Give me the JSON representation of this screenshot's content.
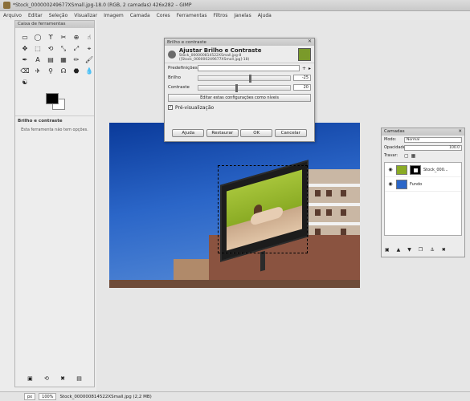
{
  "window": {
    "title": "*Stock_000000249677XSmall.jpg-18.0 (RGB, 2 camadas) 426x282 – GIMP"
  },
  "menu": [
    "Arquivo",
    "Editar",
    "Seleção",
    "Visualizar",
    "Imagem",
    "Camada",
    "Cores",
    "Ferramentas",
    "Filtros",
    "Janelas",
    "Ajuda"
  ],
  "toolbox": {
    "title": "Caixa de ferramentas",
    "tools": [
      "▭",
      "◯",
      "ϒ",
      "✂",
      "⊕",
      "☝",
      "✥",
      "⬚",
      "⟲",
      "⤡",
      "⤢",
      "⌖",
      "✒",
      "A",
      "▤",
      "▦",
      "✏",
      "🖌",
      "⌫",
      "✈",
      "⚲",
      "☊",
      "⬣",
      "💧",
      "☯"
    ],
    "options_title": "Brilho e contraste",
    "options_note": "Esta ferramenta não tem opções.",
    "bottom_icons": [
      "save-icon",
      "restore-icon",
      "delete-icon",
      "reset-icon"
    ]
  },
  "dialog": {
    "title": "Brilho e contraste",
    "heading": "Ajustar Brilho e Contraste",
    "subheading": "Stock_000000814522XSmall.jpg-8 ([Stock_000000249677XSmall.jpg]-18)",
    "presets_label": "Predefinições:",
    "brightness_label": "Brilho",
    "brightness_value": "-25",
    "contrast_label": "Contraste",
    "contrast_value": "20",
    "brightness_level": 0.55,
    "contrast_level": 0.4,
    "edit_levels": "Editar estas configurações como níveis",
    "preview_label": "Pré-visualização",
    "preview_checked": true,
    "buttons": {
      "help": "Ajuda",
      "reset": "Restaurar",
      "ok": "OK",
      "cancel": "Cancelar"
    }
  },
  "layers": {
    "title": "Camadas",
    "mode_label": "Modo:",
    "mode_value": "Normal",
    "opacity_label": "Opacidade:",
    "opacity_value": "100.0",
    "lock_label": "Travar:",
    "items": [
      {
        "name": "Stock_000..."
      },
      {
        "name": "Fundo"
      }
    ]
  },
  "status": {
    "unit": "px",
    "zoom": "100%",
    "info": "Stock_000000814522XSmall.jpg (2,2 MB)"
  }
}
